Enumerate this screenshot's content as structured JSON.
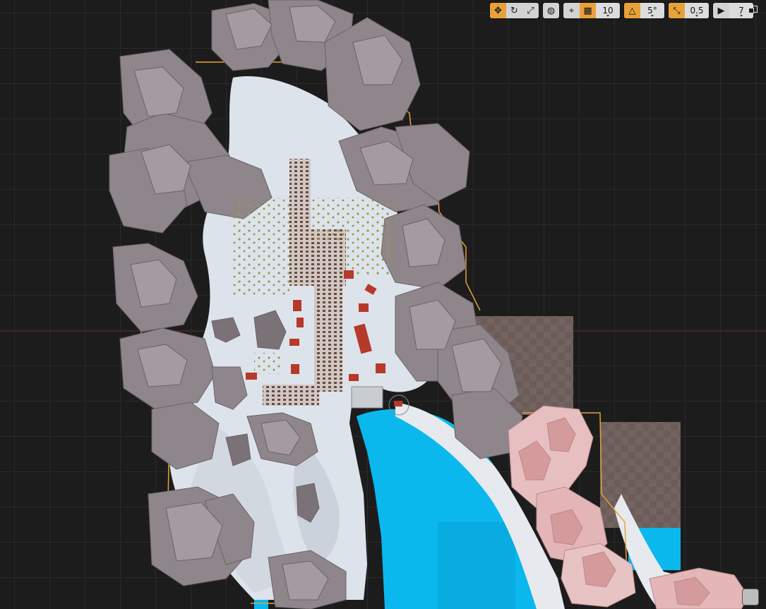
{
  "viewport": {
    "colors": {
      "background": "#1c1c1c",
      "grid": "#2a2a2a",
      "axis": "#5a1e1e",
      "snow": "#dfe4ea",
      "rock": "#8d8489",
      "water": "#0ab8ee",
      "selection": "#e8a13a",
      "roof": "#b6392a",
      "checker": "#6e5e5b"
    }
  },
  "toolbar": {
    "transform": {
      "move_icon": "move-icon",
      "rotate_icon": "rotate-icon",
      "scale_icon": "scale-icon"
    },
    "coordinate_icon": "world-globe-icon",
    "surface_snap_icon": "surface-snapping-icon",
    "grid_snap": {
      "icon": "grid-snap-icon",
      "value": "10"
    },
    "rotation_snap": {
      "icon": "rotation-snap-icon",
      "value": "5°"
    },
    "scale_snap": {
      "icon": "scale-snap-icon",
      "value": "0.5"
    },
    "camera_speed": {
      "icon": "camera-speed-icon",
      "value": "7"
    },
    "maximize_icon": "maximize-viewport-icon"
  },
  "corner_widget_icon": "view-options-icon"
}
